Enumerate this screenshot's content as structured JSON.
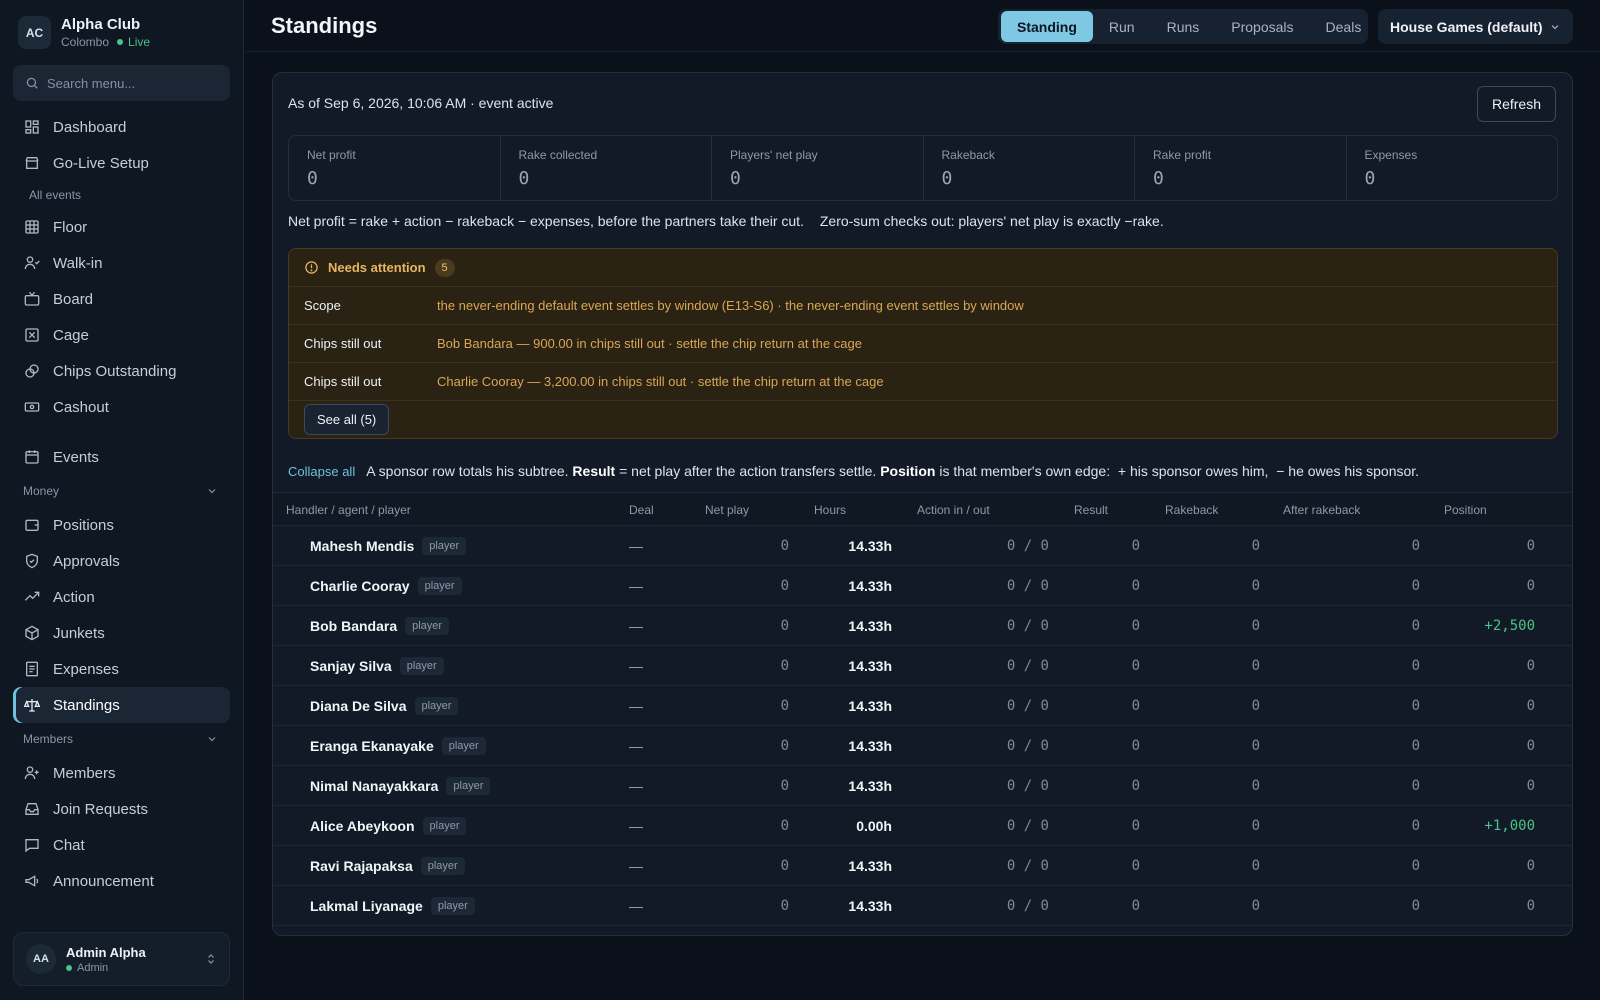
{
  "club": {
    "initials": "AC",
    "name": "Alpha Club",
    "location": "Colombo",
    "status": "Live"
  },
  "search": {
    "placeholder": "Search menu..."
  },
  "nav": {
    "top": [
      {
        "label": "Dashboard",
        "icon": "dashboard-icon"
      },
      {
        "label": "Go-Live Setup",
        "icon": "store-icon"
      }
    ],
    "all_events_label": "All events",
    "events_items": [
      {
        "label": "Floor",
        "icon": "grid-icon"
      },
      {
        "label": "Walk-in",
        "icon": "user-walkin-icon"
      },
      {
        "label": "Board",
        "icon": "tv-icon"
      },
      {
        "label": "Cage",
        "icon": "cage-icon"
      },
      {
        "label": "Chips Outstanding",
        "icon": "chips-icon"
      },
      {
        "label": "Cashout",
        "icon": "cash-icon"
      }
    ],
    "events_label": "Events",
    "money_label": "Money",
    "money_items": [
      {
        "label": "Positions",
        "icon": "wallet-icon"
      },
      {
        "label": "Approvals",
        "icon": "shield-check-icon"
      },
      {
        "label": "Action",
        "icon": "trend-icon"
      },
      {
        "label": "Junkets",
        "icon": "package-icon"
      },
      {
        "label": "Expenses",
        "icon": "receipt-icon"
      },
      {
        "label": "Standings",
        "icon": "scale-icon"
      }
    ],
    "members_label": "Members",
    "members_items": [
      {
        "label": "Members",
        "icon": "user-plus-icon"
      },
      {
        "label": "Join Requests",
        "icon": "inbox-icon"
      },
      {
        "label": "Chat",
        "icon": "chat-icon"
      },
      {
        "label": "Announcement",
        "icon": "megaphone-icon"
      }
    ]
  },
  "user": {
    "initials": "AA",
    "name": "Admin Alpha",
    "role": "Admin"
  },
  "header": {
    "title": "Standings",
    "tabs": [
      "Standing",
      "Run",
      "Runs",
      "Proposals",
      "Deals"
    ],
    "active_tab": "Standing",
    "game_select": "House Games (default)"
  },
  "summary": {
    "as_of": "As of Sep 6, 2026, 10:06 AM · event active",
    "refresh_label": "Refresh",
    "stats": [
      {
        "label": "Net profit",
        "value": "0"
      },
      {
        "label": "Rake collected",
        "value": "0"
      },
      {
        "label": "Players' net play",
        "value": "0"
      },
      {
        "label": "Rakeback",
        "value": "0"
      },
      {
        "label": "Rake profit",
        "value": "0"
      },
      {
        "label": "Expenses",
        "value": "0"
      }
    ],
    "formula": "Net profit = rake + action − rakeback − expenses, before the partners take their cut.",
    "zero_sum": "Zero-sum checks out: players' net play is exactly −rake."
  },
  "attention": {
    "title": "Needs attention",
    "count": "5",
    "rows": [
      {
        "key": "Scope",
        "value": "the never-ending default event settles by window (E13-S6) · the never-ending event settles by window"
      },
      {
        "key": "Chips still out",
        "value": "Bob Bandara — 900.00 in chips still out · settle the chip return at the cage"
      },
      {
        "key": "Chips still out",
        "value": "Charlie Cooray — 3,200.00 in chips still out · settle the chip return at the cage"
      }
    ],
    "see_all": "See all (5)"
  },
  "tree_note": {
    "collapse_all": "Collapse all",
    "part1": "A sponsor row totals his subtree.",
    "result_bold": "Result",
    "part2": "= net play after the action transfers settle.",
    "position_bold": "Position",
    "part3": "is that member's own edge:",
    "plus": "+ his sponsor owes him,",
    "minus": "− he owes his sponsor."
  },
  "table": {
    "columns": [
      "Handler / agent / player",
      "Deal",
      "Net play",
      "Hours",
      "Action in / out",
      "Result",
      "Rakeback",
      "After rakeback",
      "Position"
    ],
    "rows": [
      {
        "name": "Mahesh Mendis",
        "tag": "player",
        "deal": "—",
        "net_play": "0",
        "hours": "14.33h",
        "action": "0 / 0",
        "result": "0",
        "rakeback": "0",
        "after_rakeback": "0",
        "position": "0"
      },
      {
        "name": "Charlie Cooray",
        "tag": "player",
        "deal": "—",
        "net_play": "0",
        "hours": "14.33h",
        "action": "0 / 0",
        "result": "0",
        "rakeback": "0",
        "after_rakeback": "0",
        "position": "0"
      },
      {
        "name": "Bob Bandara",
        "tag": "player",
        "deal": "—",
        "net_play": "0",
        "hours": "14.33h",
        "action": "0 / 0",
        "result": "0",
        "rakeback": "0",
        "after_rakeback": "0",
        "position": "+2,500"
      },
      {
        "name": "Sanjay Silva",
        "tag": "player",
        "deal": "—",
        "net_play": "0",
        "hours": "14.33h",
        "action": "0 / 0",
        "result": "0",
        "rakeback": "0",
        "after_rakeback": "0",
        "position": "0"
      },
      {
        "name": "Diana De Silva",
        "tag": "player",
        "deal": "—",
        "net_play": "0",
        "hours": "14.33h",
        "action": "0 / 0",
        "result": "0",
        "rakeback": "0",
        "after_rakeback": "0",
        "position": "0"
      },
      {
        "name": "Eranga Ekanayake",
        "tag": "player",
        "deal": "—",
        "net_play": "0",
        "hours": "14.33h",
        "action": "0 / 0",
        "result": "0",
        "rakeback": "0",
        "after_rakeback": "0",
        "position": "0"
      },
      {
        "name": "Nimal Nanayakkara",
        "tag": "player",
        "deal": "—",
        "net_play": "0",
        "hours": "14.33h",
        "action": "0 / 0",
        "result": "0",
        "rakeback": "0",
        "after_rakeback": "0",
        "position": "0"
      },
      {
        "name": "Alice Abeykoon",
        "tag": "player",
        "deal": "—",
        "net_play": "0",
        "hours": "0.00h",
        "action": "0 / 0",
        "result": "0",
        "rakeback": "0",
        "after_rakeback": "0",
        "position": "+1,000"
      },
      {
        "name": "Ravi Rajapaksa",
        "tag": "player",
        "deal": "—",
        "net_play": "0",
        "hours": "14.33h",
        "action": "0 / 0",
        "result": "0",
        "rakeback": "0",
        "after_rakeback": "0",
        "position": "0"
      },
      {
        "name": "Lakmal Liyanage",
        "tag": "player",
        "deal": "—",
        "net_play": "0",
        "hours": "14.33h",
        "action": "0 / 0",
        "result": "0",
        "rakeback": "0",
        "after_rakeback": "0",
        "position": "0"
      }
    ]
  },
  "colors": {
    "accent": "#7fc8e3",
    "positive": "#4cc38a",
    "warning": "#e8b560"
  }
}
